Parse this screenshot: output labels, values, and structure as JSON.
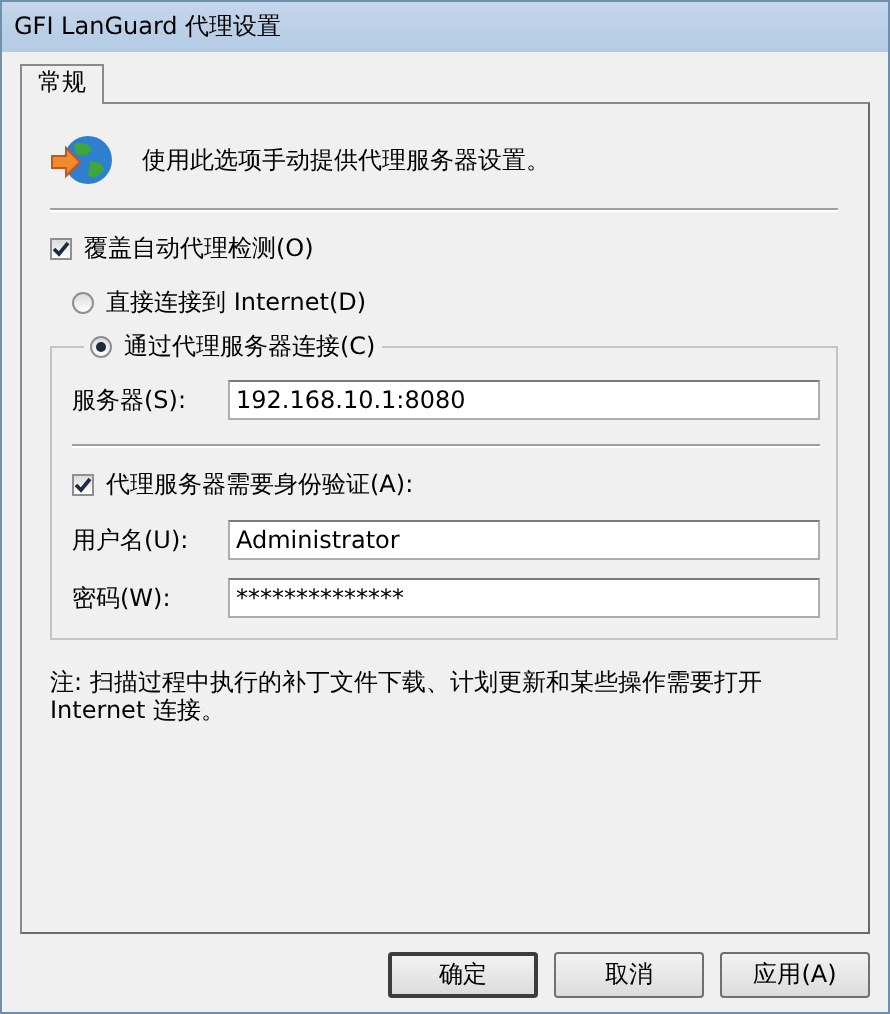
{
  "window": {
    "title": "GFI LanGuard 代理设置"
  },
  "tabs": [
    {
      "label": "常规",
      "selected": true
    }
  ],
  "description": "使用此选项手动提供代理服务器设置。",
  "override": {
    "label": "覆盖自动代理检测(O)",
    "checked": true
  },
  "connection": [
    {
      "label": "直接连接到 Internet(D)",
      "selected": false
    },
    {
      "label": "通过代理服务器连接(C)",
      "selected": true
    }
  ],
  "server": {
    "label": "服务器(S):",
    "value": "192.168.10.1:8080"
  },
  "auth": {
    "label": "代理服务器需要身份验证(A):",
    "checked": true
  },
  "username": {
    "label": "用户名(U):",
    "value": "Administrator"
  },
  "password": {
    "label": "密码(W):",
    "value": "**************"
  },
  "note": "注: 扫描过程中执行的补丁文件下载、计划更新和某些操作需要打开 Internet 连接。",
  "buttons": [
    {
      "label": "确定",
      "default": true
    },
    {
      "label": "取消",
      "default": false
    },
    {
      "label": "应用(A)",
      "default": false
    }
  ]
}
